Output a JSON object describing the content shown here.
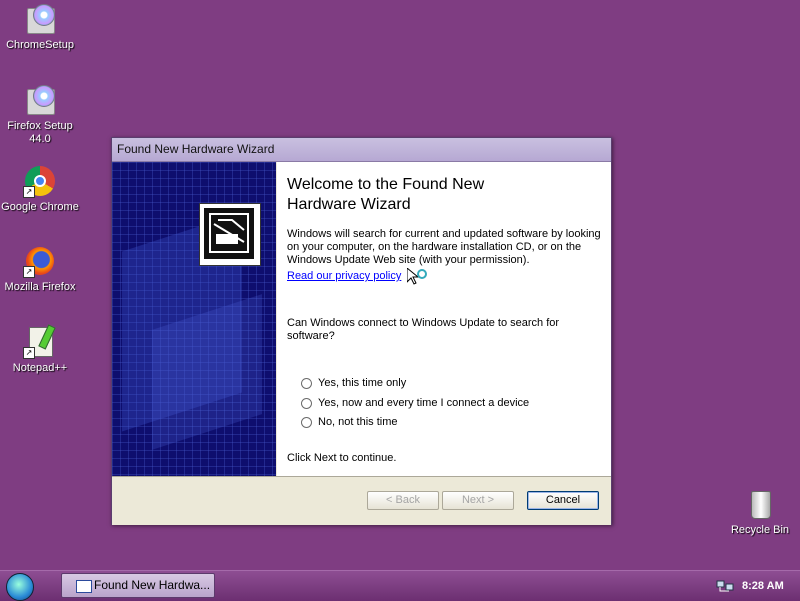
{
  "desktop": {
    "icons": [
      {
        "label": "ChromeSetup",
        "icon": "installer-icon"
      },
      {
        "label": "Firefox Setup 44.0",
        "icon": "installer-icon"
      },
      {
        "label": "Google Chrome",
        "icon": "chrome-icon"
      },
      {
        "label": "Mozilla Firefox",
        "icon": "firefox-icon"
      },
      {
        "label": "Notepad++",
        "icon": "notepadpp-icon"
      },
      {
        "label": "Recycle Bin",
        "icon": "recycle-bin-icon"
      }
    ]
  },
  "wizard": {
    "title": "Found New Hardware Wizard",
    "heading": "Welcome to the Found New Hardware Wizard",
    "description": "Windows will search for current and updated software by looking on your computer, on the hardware installation CD, or on the Windows Update Web site (with your permission).",
    "privacy_link": "Read our privacy policy",
    "question": "Can Windows connect to Windows Update to search for software?",
    "options": [
      {
        "label": "Yes, this time only",
        "selected": false
      },
      {
        "label": "Yes, now and every time I connect a device",
        "selected": false
      },
      {
        "label": "No, not this time",
        "selected": false
      }
    ],
    "continue_text": "Click Next to continue.",
    "buttons": {
      "back": "< Back",
      "next": "Next >",
      "cancel": "Cancel"
    }
  },
  "taskbar": {
    "task_label": "Found New Hardwa...",
    "clock": "8:28 AM"
  },
  "colors": {
    "desktop_bg": "#7f3d82",
    "sidebar_bg": "#0e0e6e",
    "link": "#0000ff"
  }
}
